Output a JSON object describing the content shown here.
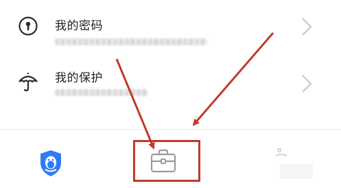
{
  "list": {
    "items": [
      {
        "title": "我的密码",
        "subtitle": "",
        "icon": "keyhole-icon"
      },
      {
        "title": "我的保护",
        "subtitle": "",
        "icon": "umbrella-icon"
      }
    ]
  },
  "tabbar": {
    "tabs": [
      {
        "icon": "shield-penguin-icon",
        "active": true
      },
      {
        "icon": "toolbox-icon",
        "active": false
      },
      {
        "icon": "tab-3-icon",
        "active": false
      }
    ]
  },
  "annotation": {
    "color": "#c0392b"
  },
  "colors": {
    "accent": "#2f7bf6",
    "inactive_icon": "#9a9a9a",
    "annotation": "#c0392b"
  }
}
